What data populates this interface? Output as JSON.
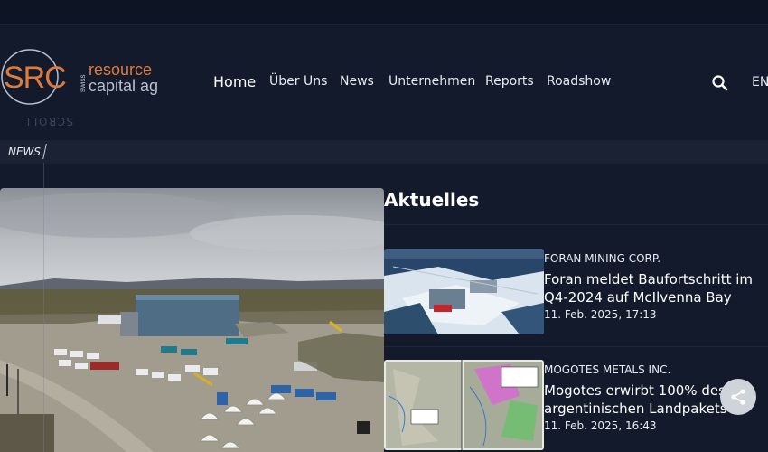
{
  "brand": {
    "logo_letters": "SRC",
    "logo_swiss": "swiss",
    "logo_line1": "resource",
    "logo_line2": "capital ag",
    "scroll_hint": "SCROLL"
  },
  "nav": {
    "items": [
      "Home",
      "Über Uns",
      "News",
      "Unternehmen",
      "Reports",
      "Roadshow"
    ],
    "active": "Home",
    "language": "EN"
  },
  "breadcrumb": {
    "current": "NEWS"
  },
  "section": {
    "title": "Aktuelles"
  },
  "news": [
    {
      "company": "FORAN MINING CORP.",
      "title": "Foran meldet Baufortschritt im Q4-2024 auf McIlvenna Bay",
      "date": "11. Feb. 2025, 17:13"
    },
    {
      "company": "MOGOTES METALS INC.",
      "title": "Mogotes erwirbt 100% des argentinischen Landpakets",
      "date": "11. Feb. 2025, 16:43"
    }
  ],
  "icons": {
    "search": "search-icon",
    "share": "share-icon"
  },
  "colors": {
    "background": "#121a2b",
    "logo_accent": "#e07b39",
    "logo_text": "#b8c0cc"
  }
}
